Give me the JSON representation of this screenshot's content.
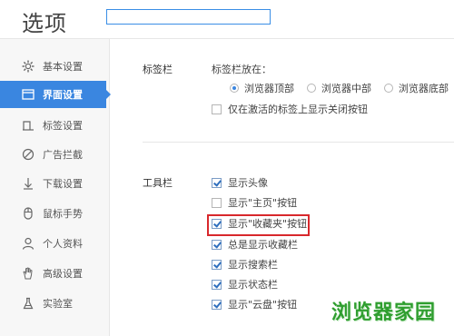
{
  "header": {
    "title": "选项",
    "search_placeholder": "",
    "search_value": ""
  },
  "sidebar": {
    "items": [
      {
        "label": "基本设置",
        "icon": "gear-icon"
      },
      {
        "label": "界面设置",
        "icon": "window-icon",
        "active": true
      },
      {
        "label": "标签设置",
        "icon": "tab-icon"
      },
      {
        "label": "广告拦截",
        "icon": "block-icon"
      },
      {
        "label": "下载设置",
        "icon": "download-icon"
      },
      {
        "label": "鼠标手势",
        "icon": "mouse-icon"
      },
      {
        "label": "个人资料",
        "icon": "person-icon"
      },
      {
        "label": "高级设置",
        "icon": "hand-icon"
      },
      {
        "label": "实验室",
        "icon": "flask-icon"
      }
    ]
  },
  "main": {
    "tabbar": {
      "section_label": "标签栏",
      "position_label": "标签栏放在：",
      "positions": [
        "浏览器顶部",
        "浏览器中部",
        "浏览器底部"
      ],
      "selected_position": "浏览器顶部",
      "close_only_active": {
        "label": "仅在激活的标签上显示关闭按钮",
        "checked": false
      }
    },
    "toolbar": {
      "section_label": "工具栏",
      "options": [
        {
          "label": "显示头像",
          "checked": true
        },
        {
          "label": "显示\"主页\"按钮",
          "checked": false
        },
        {
          "label": "显示\"收藏夹\"按钮",
          "checked": true,
          "highlighted": true
        },
        {
          "label": "总是显示收藏栏",
          "checked": true
        },
        {
          "label": "显示搜索栏",
          "checked": true
        },
        {
          "label": "显示状态栏",
          "checked": true
        },
        {
          "label": "显示\"云盘\"按钮",
          "checked": true
        }
      ]
    }
  },
  "watermark": "浏览器家园",
  "colors": {
    "accent": "#3a86e0",
    "highlight_border": "#d8282c",
    "watermark": "#2f9e2f"
  }
}
